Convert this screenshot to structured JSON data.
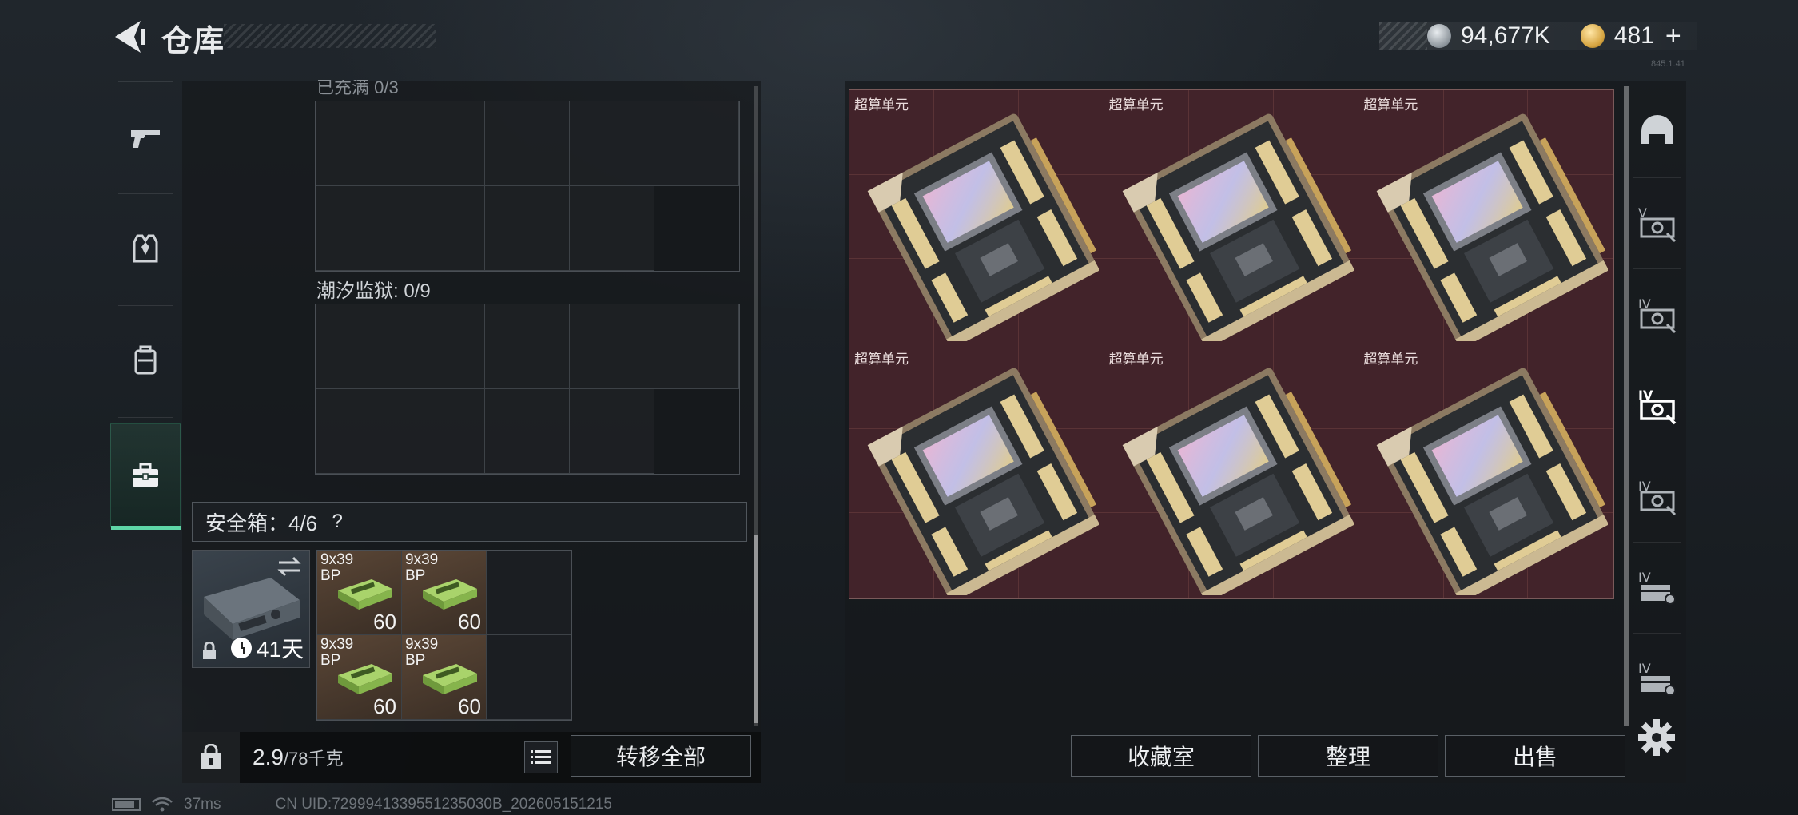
{
  "header": {
    "title": "仓库",
    "currency_silver": "94,677K",
    "currency_gold": "481",
    "gold_plus": "+",
    "tiny_version": "845.1.41"
  },
  "left_nav": {
    "items": [
      {
        "name": "weapons",
        "icon": "pistol-icon"
      },
      {
        "name": "armor",
        "icon": "vest-icon"
      },
      {
        "name": "backpack",
        "icon": "backpack-icon"
      },
      {
        "name": "secure-container",
        "icon": "briefcase-icon",
        "active": true
      }
    ]
  },
  "storage": {
    "partial_label": "已充满 0/3",
    "prison_label": "潮汐监狱: 0/9",
    "safe_label": "安全箱：4/6",
    "safe_help": "?",
    "safe_days": "41天",
    "ammo": [
      {
        "name": "9x39",
        "sub": "BP",
        "qty": "60"
      },
      {
        "name": "9x39",
        "sub": "BP",
        "qty": "60"
      },
      {
        "name": "9x39",
        "sub": "BP",
        "qty": "60"
      },
      {
        "name": "9x39",
        "sub": "BP",
        "qty": "60"
      }
    ]
  },
  "weight": {
    "current": "2.9",
    "max": "/78千克"
  },
  "buttons": {
    "transfer_all": "转移全部",
    "collection_room": "收藏室",
    "organize": "整理",
    "sell": "出售"
  },
  "loot": {
    "items": [
      {
        "name": "超算单元"
      },
      {
        "name": "超算单元"
      },
      {
        "name": "超算单元"
      },
      {
        "name": "超算单元"
      },
      {
        "name": "超算单元"
      },
      {
        "name": "超算单元"
      }
    ]
  },
  "right_tabs": [
    {
      "icon": "helmet-icon",
      "level": ""
    },
    {
      "icon": "card-v-icon",
      "level": "V"
    },
    {
      "icon": "card-iv-icon",
      "level": "IV"
    },
    {
      "icon": "card-iv-active-icon",
      "level": "IV"
    },
    {
      "icon": "card-iv-icon",
      "level": "IV"
    },
    {
      "icon": "case-iv-icon",
      "level": "IV"
    },
    {
      "icon": "case-iv-icon",
      "level": "IV"
    }
  ],
  "status": {
    "ping": "37ms",
    "uid": "CN UID:7299941339551235030B_202605151215"
  },
  "colors": {
    "accent": "#5ed6a6",
    "loot_bg": "#42232a",
    "panel_bg": "#16191c"
  }
}
